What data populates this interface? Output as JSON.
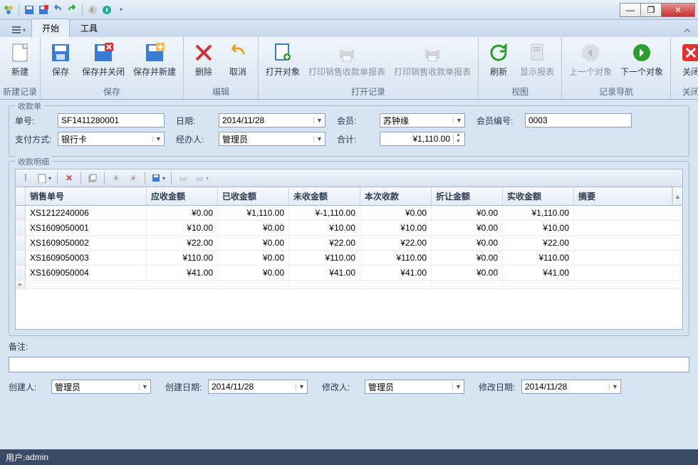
{
  "titlebar": {
    "quick_icons": [
      "app",
      "save",
      "delete",
      "undo",
      "redo",
      "prev",
      "next"
    ]
  },
  "window_controls": {
    "min": "—",
    "max": "❐",
    "close": "✕"
  },
  "ribbon": {
    "menu_label": "",
    "tabs": [
      "开始",
      "工具"
    ],
    "active_tab": 0,
    "groups": [
      {
        "label": "新建记录",
        "items": [
          {
            "label": "新建",
            "icon": "new"
          }
        ]
      },
      {
        "label": "保存",
        "items": [
          {
            "label": "保存",
            "icon": "save"
          },
          {
            "label": "保存并关闭",
            "icon": "save-close"
          },
          {
            "label": "保存并新建",
            "icon": "save-new"
          }
        ]
      },
      {
        "label": "编辑",
        "items": [
          {
            "label": "删除",
            "icon": "delete"
          },
          {
            "label": "取消",
            "icon": "undo"
          }
        ]
      },
      {
        "label": "打开记录",
        "items": [
          {
            "label": "打开对象",
            "icon": "open"
          },
          {
            "label": "打印销售收款单报表",
            "icon": "print",
            "disabled": true
          },
          {
            "label": "打印销售收款单报表",
            "icon": "print",
            "disabled": true
          }
        ]
      },
      {
        "label": "视图",
        "items": [
          {
            "label": "刷新",
            "icon": "refresh"
          },
          {
            "label": "显示报表",
            "icon": "report",
            "disabled": true
          }
        ]
      },
      {
        "label": "记录导航",
        "items": [
          {
            "label": "上一个对象",
            "icon": "prev",
            "disabled": true
          },
          {
            "label": "下一个对象",
            "icon": "next"
          }
        ]
      },
      {
        "label": "关闭",
        "items": [
          {
            "label": "关闭",
            "icon": "close"
          }
        ]
      }
    ]
  },
  "receipt": {
    "legend": "收款单",
    "fields": {
      "bill_no_label": "单号:",
      "bill_no": "SF1411280001",
      "date_label": "日期:",
      "date": "2014/11/28",
      "member_label": "会员:",
      "member": "苏钟缘",
      "member_no_label": "会员编号:",
      "member_no": "0003",
      "pay_method_label": "支付方式:",
      "pay_method": "银行卡",
      "operator_label": "经办人:",
      "operator": "管理员",
      "total_label": "合计:",
      "total": "¥1,110.00"
    }
  },
  "detail": {
    "legend": "收款明细",
    "columns": [
      "销售单号",
      "应收金额",
      "已收金额",
      "未收金额",
      "本次收款",
      "折让金额",
      "实收金额",
      "摘要"
    ],
    "rows": [
      {
        "sn": "XS1212240006",
        "due": "¥0.00",
        "paid": "¥1,110.00",
        "unpaid": "¥-1,110.00",
        "this": "¥0.00",
        "disc": "¥0.00",
        "actual": "¥1,110.00",
        "memo": ""
      },
      {
        "sn": "XS1609050001",
        "due": "¥10.00",
        "paid": "¥0.00",
        "unpaid": "¥10.00",
        "this": "¥10.00",
        "disc": "¥0.00",
        "actual": "¥10.00",
        "memo": ""
      },
      {
        "sn": "XS1609050002",
        "due": "¥22.00",
        "paid": "¥0.00",
        "unpaid": "¥22.00",
        "this": "¥22.00",
        "disc": "¥0.00",
        "actual": "¥22.00",
        "memo": ""
      },
      {
        "sn": "XS1609050003",
        "due": "¥110.00",
        "paid": "¥0.00",
        "unpaid": "¥110.00",
        "this": "¥110.00",
        "disc": "¥0.00",
        "actual": "¥110.00",
        "memo": ""
      },
      {
        "sn": "XS1609050004",
        "due": "¥41.00",
        "paid": "¥0.00",
        "unpaid": "¥41.00",
        "this": "¥41.00",
        "disc": "¥0.00",
        "actual": "¥41.00",
        "memo": ""
      }
    ]
  },
  "remarks": {
    "label": "备注:",
    "value": ""
  },
  "footer": {
    "creator_label": "创建人:",
    "creator": "管理员",
    "create_date_label": "创建日期:",
    "create_date": "2014/11/28",
    "modifier_label": "修改人:",
    "modifier": "管理员",
    "modify_date_label": "修改日期:",
    "modify_date": "2014/11/28"
  },
  "statusbar": {
    "user_label": "用户: ",
    "user": "admin"
  }
}
